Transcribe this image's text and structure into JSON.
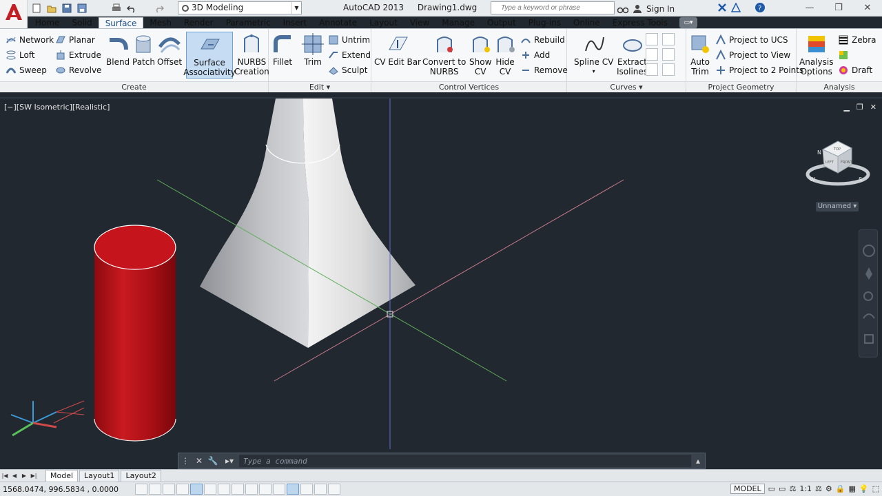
{
  "title_bar": {
    "workspace": "3D Modeling",
    "app_name": "AutoCAD 2013",
    "document": "Drawing1.dwg",
    "search_placeholder": "Type a keyword or phrase",
    "sign_in": "Sign In"
  },
  "ribbon_tabs": [
    "Home",
    "Solid",
    "Surface",
    "Mesh",
    "Render",
    "Parametric",
    "Insert",
    "Annotate",
    "Layout",
    "View",
    "Manage",
    "Output",
    "Plug-ins",
    "Online",
    "Express Tools"
  ],
  "active_tab": "Surface",
  "panels": {
    "create": {
      "title": "Create",
      "small_left": [
        "Network",
        "Loft",
        "Sweep"
      ],
      "small_right": [
        "Planar",
        "Extrude",
        "Revolve"
      ],
      "large": [
        "Blend",
        "Patch",
        "Offset"
      ],
      "surface_assoc": [
        "Surface",
        "Associativity"
      ],
      "nurbs": [
        "NURBS",
        "Creation"
      ]
    },
    "edit": {
      "title": "Edit",
      "large": [
        "Fillet",
        "Trim"
      ],
      "small": [
        "Untrim",
        "Extend",
        "Sculpt"
      ]
    },
    "control_vertices": {
      "title": "Control Vertices",
      "cv_edit_bar": "CV Edit Bar",
      "convert": [
        "Convert to",
        "NURBS"
      ],
      "show_cv": [
        "Show",
        "CV"
      ],
      "hide_cv": [
        "Hide",
        "CV"
      ],
      "small": [
        "Rebuild",
        "Add",
        "Remove"
      ]
    },
    "curves": {
      "title": "Curves",
      "spline_cv": "Spline CV",
      "extract": [
        "Extract",
        "Isolines"
      ]
    },
    "project_geometry": {
      "title": "Project Geometry",
      "auto_trim": [
        "Auto",
        "Trim"
      ],
      "small": [
        "Project to UCS",
        "Project to View",
        "Project to 2 Points"
      ]
    },
    "analysis": {
      "title": "Analysis",
      "options": [
        "Analysis",
        "Options"
      ],
      "small": [
        "Zebra",
        "",
        "Draft"
      ]
    }
  },
  "viewport": {
    "label": "[−][SW Isometric][Realistic]",
    "ucs_name": "Unnamed",
    "viewcube": {
      "top": "TOP",
      "left": "LEFT",
      "front": "FRONT",
      "compass": [
        "N",
        "W",
        "S"
      ]
    }
  },
  "command_line": {
    "placeholder": "Type a command"
  },
  "layout_tabs": [
    "Model",
    "Layout1",
    "Layout2"
  ],
  "status_bar": {
    "coordinates": "1568.0474,  996.5834 , 0.0000",
    "model": "MODEL",
    "scale": "1:1"
  },
  "colors": {
    "viewport_bg": "#212830",
    "cylinder": "#a50c12",
    "surface": "#d8d8d8",
    "x_axis": "#c97a8a",
    "y_axis": "#5fae5a",
    "z_axis": "#5a6bd1",
    "active_tab": "#1b4f8c"
  }
}
